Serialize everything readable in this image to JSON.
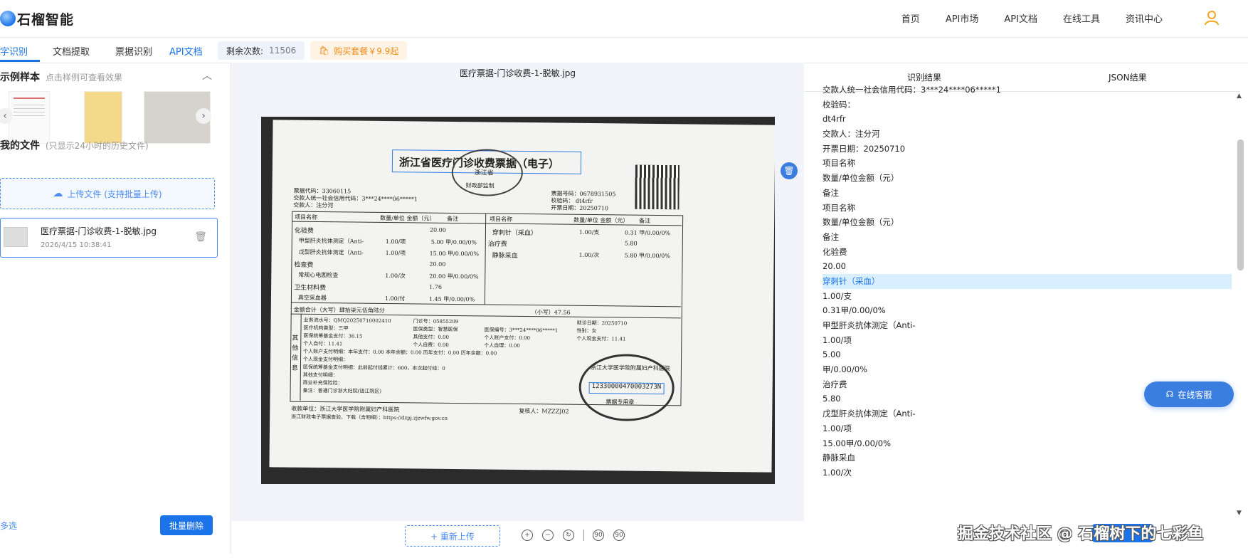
{
  "header": {
    "brand": "石榴智能",
    "nav": [
      "首页",
      "API市场",
      "API文档",
      "在线工具",
      "资讯中心"
    ]
  },
  "tabs": {
    "items": [
      "字识别",
      "文档提取",
      "票据识别",
      "API文档"
    ],
    "remaining_label": "剩余次数:",
    "remaining_value": "11506",
    "buy_label": "购买套餐￥9.9起"
  },
  "left": {
    "samples_title": "示例样本",
    "samples_hint": "点击样例可查看效果",
    "files_title": "我的文件",
    "files_hint": "(只显示24小时的历史文件)",
    "upload_label": "上传文件 (支持批量上传)",
    "file": {
      "name": "医疗票据-门诊收费-1-脱敏.jpg",
      "date": "2026/4/15 10:38:41"
    },
    "multi_select": "多选",
    "bulk_delete": "批量删除"
  },
  "center": {
    "doc_title": "医疗票据-门诊收费-1-脱敏.jpg",
    "reupload": "+ 重新上传",
    "invoice": {
      "title": "浙江省医疗门诊收费票据（电子）",
      "seal_top": "浙江省",
      "seal_bottom": "财政部监制",
      "code": "票据代码：33060115",
      "payer_code": "交款人统一社会信用代码：3***24****06*****1",
      "payer": "交款人：注分河",
      "number": "票据号码：0678931505",
      "check": "校验码：  dt4rfr",
      "date": "开票日期：20250710",
      "col_item": "项目名称",
      "col_qty": "数量/单位 金额（元）",
      "col_note": "备注",
      "rows_left": [
        [
          "化验费",
          "",
          "20.00"
        ],
        [
          "甲型肝炎抗体测定（Anti-",
          "1.00/项",
          "5.00 甲/0.00/0%"
        ],
        [
          "戊型肝炎抗体测定（Anti-",
          "1.00/项",
          "15.00 甲/0.00/0%"
        ],
        [
          "检查费",
          "",
          "20.00"
        ],
        [
          "常规心电图检查",
          "1.00/次",
          "20.00 甲/0.00/0%"
        ],
        [
          "卫生材料费",
          "",
          "1.76"
        ],
        [
          "真空采血器",
          "1.00/付",
          "1.45 甲/0.00/0%"
        ]
      ],
      "rows_right": [
        [
          "穿刺针（采血）",
          "1.00/支",
          "0.31 甲/0.00/0%"
        ],
        [
          "治疗费",
          "",
          "5.80"
        ],
        [
          "静脉采血",
          "1.00/次",
          "5.80 甲/0.00/0%"
        ]
      ],
      "total_cn": "金额合计（大写）肆拾柒元伍角陆分",
      "total_num": "（小写）47.56",
      "other_label": "其他信息",
      "other_lines": [
        "业务流水号：QMQ20250710002410",
        "医疗机构类型：三甲",
        "医保统筹基金支付：36.15",
        "个人自付：11.41",
        "个人账户支付明细：本年支付：0.00 本年余额：0.00 历年支付：0.00 历年余额：0.00",
        "个人现金支付明细：",
        "医保统筹基金支付明细：此前起付线累计：600，本次起付线：0",
        "其他支付明细：",
        "商业补充保险险：",
        "备注：普通门诊浙大妇院(钱江院区)"
      ],
      "other_mid": [
        "门诊号：05855209",
        "医保类型：智慧医保",
        "其他支付：0.00",
        "个人自费：0.00"
      ],
      "other_right": [
        "就诊日期：20250710",
        "医保编号：3***24****06*****1",
        "性别：女",
        "个人账户支付：0.00",
        "个人自理：0.00",
        "个人现金支付：11.41"
      ],
      "payee": "收款单位：浙江大学医学院附属妇产科医院",
      "reviewer": "复核人：MZZZJ02",
      "footer": "浙江财政电子票据查验、下载（含明细）：https://dzpj.zjzwfw.gov.cn",
      "stamp_code": "12330000470003273N",
      "stamp_text": "浙江大学医学院附属妇产科医院",
      "stamp_bottom": "票据专用章"
    }
  },
  "right": {
    "tab_result": "识别结果",
    "tab_json": "JSON结果",
    "lines": [
      "交款人统一社会信用代码：3***24****06*****1",
      "校验码：",
      "dt4rfr",
      "交款人：注分河",
      "开票日期：20250710",
      "项目名称",
      "数量/单位金额（元）",
      "备注",
      "项目名称",
      "数量/单位金额（元）",
      "备注",
      "化验费",
      "20.00",
      "穿刺针（采血）",
      "1.00/支",
      "0.31甲/0.00/0%",
      "甲型肝炎抗体测定（Anti-",
      "1.00/项",
      "5.00",
      "甲/0.00/0%",
      "治疗费",
      "5.80",
      "戊型肝炎抗体测定（Anti-",
      "1.00/项",
      "15.00甲/0.00/0%",
      "静脉采血",
      "1.00/次"
    ],
    "highlight_index": 13,
    "service": "在线客服"
  },
  "watermark": "掘金技术社区 @ 石榴树下的七彩鱼"
}
